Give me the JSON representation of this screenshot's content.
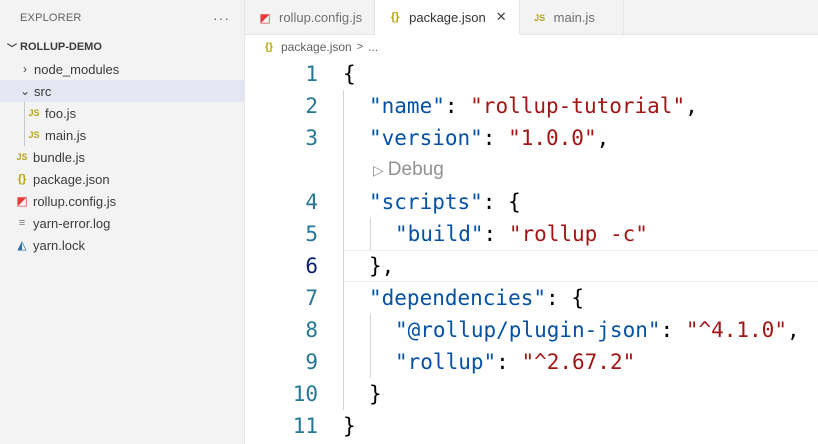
{
  "sidebar": {
    "title": "EXPLORER",
    "more": "···",
    "root": "ROLLUP-DEMO",
    "items": [
      {
        "label": "node_modules",
        "icon": "chevron-right-icon"
      },
      {
        "label": "src",
        "icon": "chevron-down-icon"
      },
      {
        "label": "foo.js",
        "icon": "js-file-icon",
        "badge": "JS"
      },
      {
        "label": "main.js",
        "icon": "js-file-icon",
        "badge": "JS"
      },
      {
        "label": "bundle.js",
        "icon": "js-file-icon",
        "badge": "JS"
      },
      {
        "label": "package.json",
        "icon": "json-file-icon",
        "badge": "{}"
      },
      {
        "label": "rollup.config.js",
        "icon": "rollup-file-icon"
      },
      {
        "label": "yarn-error.log",
        "icon": "log-file-icon"
      },
      {
        "label": "yarn.lock",
        "icon": "yarn-file-icon"
      }
    ]
  },
  "tabs": [
    {
      "label": "rollup.config.js",
      "icon": "rollup-file-icon"
    },
    {
      "label": "package.json",
      "icon": "json-file-icon",
      "badge": "{}",
      "active": true
    },
    {
      "label": "main.js",
      "icon": "js-file-icon",
      "badge": "JS"
    }
  ],
  "breadcrumb": {
    "file": "package.json",
    "badge": "{}",
    "sep": ">",
    "rest": "..."
  },
  "editor": {
    "codelens": "Debug",
    "lines": [
      {
        "n": "1"
      },
      {
        "n": "2"
      },
      {
        "n": "3"
      },
      {
        "n": "4"
      },
      {
        "n": "5"
      },
      {
        "n": "6"
      },
      {
        "n": "7"
      },
      {
        "n": "8"
      },
      {
        "n": "9"
      },
      {
        "n": "10"
      },
      {
        "n": "11"
      }
    ],
    "tokens": {
      "open_brace": "{",
      "close_brace": "}",
      "close_brace_comma": "},",
      "colon": ": ",
      "comma": ",",
      "name_key": "\"name\"",
      "name_val": "\"rollup-tutorial\"",
      "version_key": "\"version\"",
      "version_val": "\"1.0.0\"",
      "scripts_key": "\"scripts\"",
      "build_key": "\"build\"",
      "build_val": "\"rollup -c\"",
      "deps_key": "\"dependencies\"",
      "json_key": "\"@rollup/plugin-json\"",
      "json_val": "\"^4.1.0\"",
      "rollup_key": "\"rollup\"",
      "rollup_val": "\"^2.67.2\""
    }
  },
  "colors": {
    "key": "#0451a5",
    "string": "#a31515",
    "line_number": "#237893"
  }
}
